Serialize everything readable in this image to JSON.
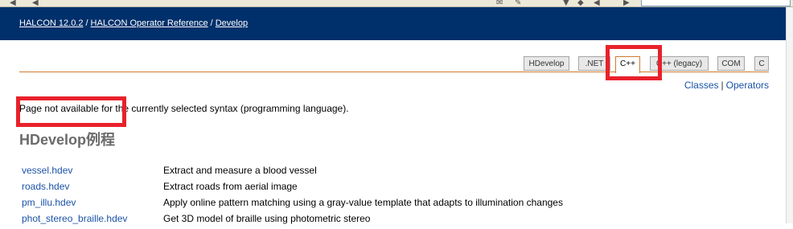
{
  "breadcrumb": {
    "item1": "HALCON 12.0.2",
    "item2": "HALCON Operator Reference",
    "item3": "Develop",
    "separator": "/"
  },
  "tabs": [
    {
      "label": "HDevelop"
    },
    {
      "label": ".NET"
    },
    {
      "label": "C++",
      "active": true
    },
    {
      "label": "C++ (legacy)"
    },
    {
      "label": "COM"
    },
    {
      "label": "C"
    }
  ],
  "links": {
    "classes": "Classes",
    "separator": "|",
    "operators": "Operators"
  },
  "notice": "Page not available for the currently selected syntax (programming language).",
  "heading": "HDevelop例程",
  "examples": [
    {
      "file": "vessel.hdev",
      "description": "Extract and measure a blood vessel"
    },
    {
      "file": "roads.hdev",
      "description": "Extract roads from aerial image"
    },
    {
      "file": "pm_illu.hdev",
      "description": "Apply online pattern matching using a gray-value template that adapts to illumination changes"
    },
    {
      "file": "phot_stereo_braille.hdev",
      "description": "Get 3D model of braille using photometric stereo"
    }
  ],
  "colors": {
    "banner": "#00306b",
    "link": "#1a52a8",
    "tab_accent": "#d07a2c",
    "highlight": "#e8212b",
    "heading": "#6b6b6b"
  }
}
